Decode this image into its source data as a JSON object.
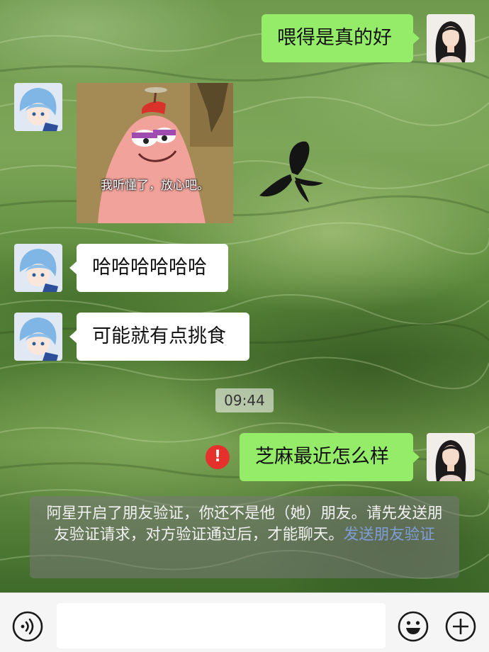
{
  "messages": [
    {
      "side": "right",
      "type": "text",
      "text": "喂得是真的好"
    },
    {
      "side": "left",
      "type": "sticker",
      "caption": "我听懂了，放心吧。"
    },
    {
      "side": "left",
      "type": "text",
      "text": "哈哈哈哈哈哈"
    },
    {
      "side": "left",
      "type": "text",
      "text": "可能就有点挑食"
    },
    {
      "type": "timestamp",
      "text": "09:44"
    },
    {
      "side": "right",
      "type": "text",
      "text": "芝麻最近怎么样",
      "status": "failed"
    }
  ],
  "notice": {
    "text": "阿星开启了朋友验证，你还不是他（她）朋友。请先发送朋友验证请求，对方验证通过后，才能聊天。",
    "link": "发送朋友验证"
  },
  "input_bar": {
    "voice_icon": "voice-icon",
    "emoji_icon": "emoji-icon",
    "plus_icon": "plus-icon",
    "input_value": ""
  },
  "colors": {
    "my_bubble": "#95ec69",
    "their_bubble": "#ffffff",
    "error_badge": "#e5302c",
    "link": "#7f9ed8"
  }
}
